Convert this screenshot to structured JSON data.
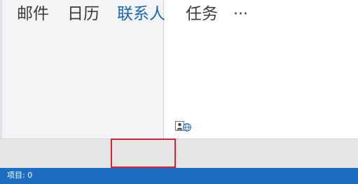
{
  "navigation": {
    "items": [
      {
        "label": "邮件",
        "active": false
      },
      {
        "label": "日历",
        "active": false
      },
      {
        "label": "联系人",
        "active": true
      },
      {
        "label": "任务",
        "active": false
      }
    ],
    "more_label": "···"
  },
  "status_bar": {
    "items_text": "项目: 0"
  },
  "colors": {
    "active_nav": "#1a68b5",
    "status_bar": "#1c6ec2",
    "highlight": "#d9232e"
  }
}
